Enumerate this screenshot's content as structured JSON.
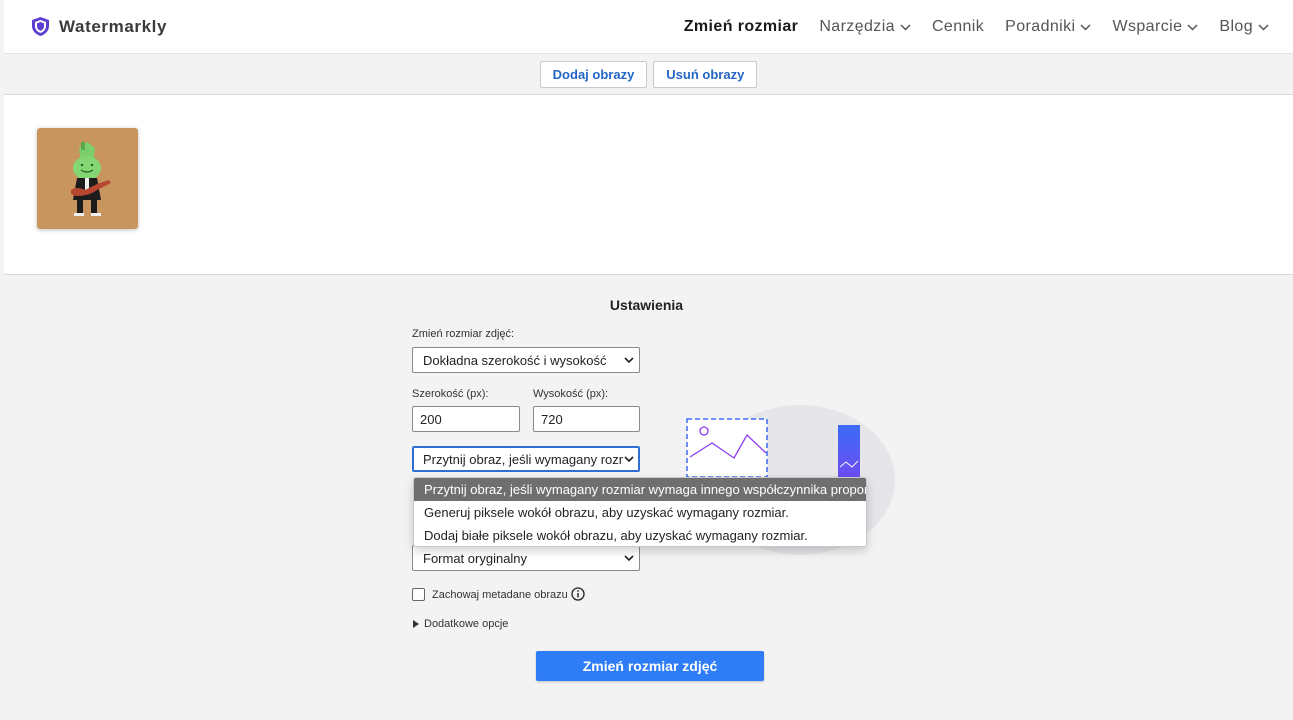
{
  "app": {
    "name": "Watermarkly"
  },
  "nav": {
    "items": [
      {
        "label": "Zmień rozmiar",
        "active": true,
        "has_menu": false
      },
      {
        "label": "Narzędzia",
        "active": false,
        "has_menu": true
      },
      {
        "label": "Cennik",
        "active": false,
        "has_menu": false
      },
      {
        "label": "Poradniki",
        "active": false,
        "has_menu": true
      },
      {
        "label": "Wsparcie",
        "active": false,
        "has_menu": true
      },
      {
        "label": "Blog",
        "active": false,
        "has_menu": true
      }
    ]
  },
  "toolbar": {
    "add_label": "Dodaj obrazy",
    "remove_label": "Usuń obrazy"
  },
  "settings": {
    "title": "Ustawienia",
    "resize_mode_label": "Zmień rozmiar zdjęć:",
    "resize_mode_value": "Dokładna szerokość i wysokość",
    "width_label": "Szerokość (px):",
    "width_value": "200",
    "height_label": "Wysokość (px):",
    "height_value": "720",
    "fit_value": "Przytnij obraz, jeśli wymagany rozm",
    "fit_options": [
      "Przytnij obraz, jeśli wymagany rozmiar wymaga innego współczynnika proporcji.",
      "Generuj piksele wokół obrazu, aby uzyskać wymagany rozmiar.",
      "Dodaj białe piksele wokół obrazu, aby uzyskać wymagany rozmiar."
    ],
    "fit_selected_index": 0,
    "format_value": "Format oryginalny",
    "keep_metadata_label": "Zachowaj metadane obrazu",
    "keep_metadata_checked": false,
    "advanced_label": "Dodatkowe opcje",
    "submit_label": "Zmień rozmiar zdjęć"
  },
  "colors": {
    "accent": "#2e7cf6",
    "link": "#2466c8",
    "brand_shield": "#5b3fd1",
    "illustration_gradient": [
      "#3b6cf6",
      "#8a3cf0"
    ]
  },
  "icons": {
    "logo": "shield-icon",
    "chevron": "chevron-down-icon",
    "select_arrow": "caret-down-icon",
    "info": "info-icon",
    "disclosure": "triangle-right-icon"
  }
}
